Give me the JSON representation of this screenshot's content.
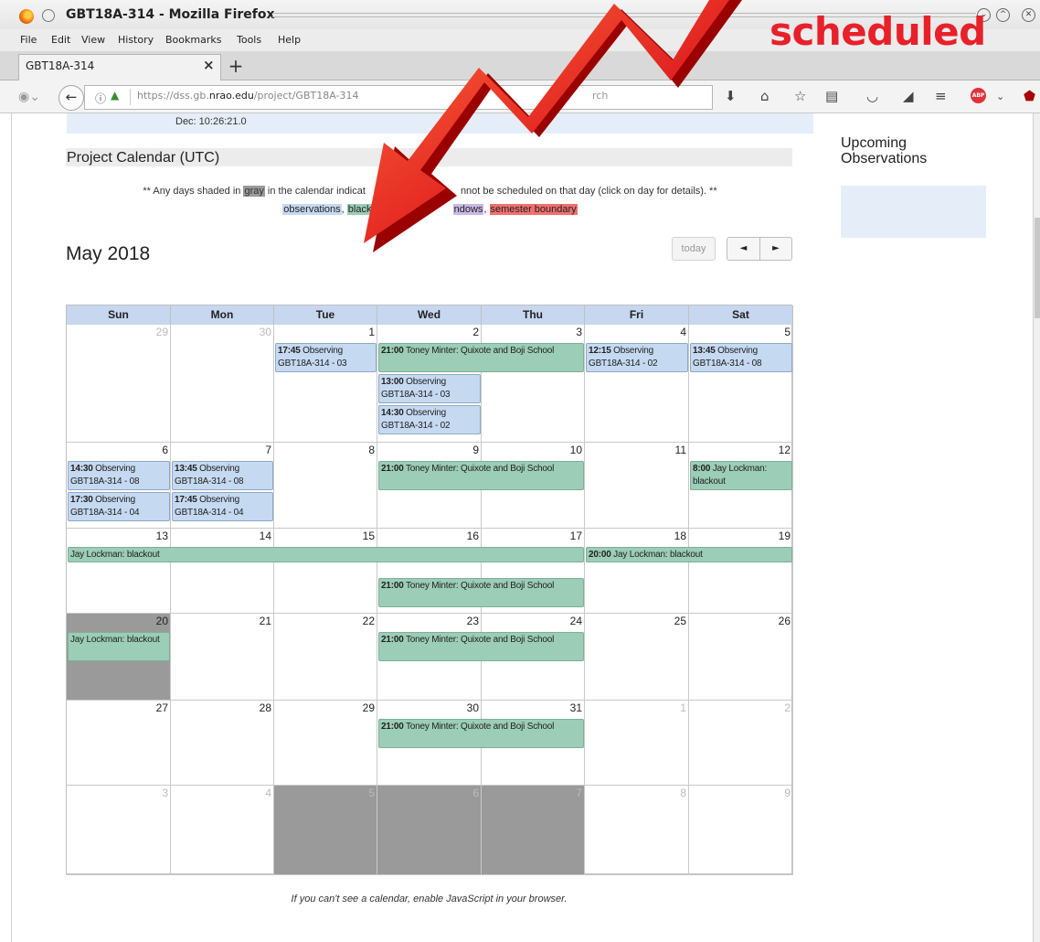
{
  "window": {
    "title": "GBT18A-314 - Mozilla Firefox"
  },
  "menu": [
    "File",
    "Edit",
    "View",
    "History",
    "Bookmarks",
    "Tools",
    "Help"
  ],
  "tab": {
    "label": "GBT18A-314",
    "close": "×",
    "new": "+"
  },
  "nav": {
    "url_prefix": "https://dss.gb.",
    "url_domain": "nrao.edu",
    "url_path": "/project/GBT18A-314",
    "search_placeholder": "rch"
  },
  "page": {
    "dec_line": "Dec: 10:26:21.0",
    "section_title": "Project Calendar (UTC)",
    "notice_prefix": "** Any days shaded in ",
    "notice_gray": "gray",
    "notice_mid": " in the calendar indicat",
    "notice_suffix": "nnot be scheduled on that day (click on day for details). **",
    "legend": {
      "obs": "observations",
      "sep1": ", ",
      "blk": "blacko",
      "win": "ndows",
      "sep3": ", ",
      "sem": "semester boundary"
    },
    "month": "May 2018",
    "today_label": "today",
    "prev_label": "◄",
    "next_label": "►",
    "footer_note": "If you can't see a calendar, enable JavaScript in your browser."
  },
  "calendar": {
    "days": [
      "Sun",
      "Mon",
      "Tue",
      "Wed",
      "Thu",
      "Fri",
      "Sat"
    ],
    "weeks": [
      [
        {
          "n": "29",
          "o": true
        },
        {
          "n": "30",
          "o": true
        },
        {
          "n": "1"
        },
        {
          "n": "2"
        },
        {
          "n": "3"
        },
        {
          "n": "4"
        },
        {
          "n": "5"
        }
      ],
      [
        {
          "n": "6"
        },
        {
          "n": "7"
        },
        {
          "n": "8"
        },
        {
          "n": "9"
        },
        {
          "n": "10"
        },
        {
          "n": "11"
        },
        {
          "n": "12"
        }
      ],
      [
        {
          "n": "13"
        },
        {
          "n": "14"
        },
        {
          "n": "15"
        },
        {
          "n": "16"
        },
        {
          "n": "17"
        },
        {
          "n": "18"
        },
        {
          "n": "19"
        }
      ],
      [
        {
          "n": "20",
          "g": true
        },
        {
          "n": "21"
        },
        {
          "n": "22"
        },
        {
          "n": "23"
        },
        {
          "n": "24"
        },
        {
          "n": "25"
        },
        {
          "n": "26"
        }
      ],
      [
        {
          "n": "27"
        },
        {
          "n": "28"
        },
        {
          "n": "29"
        },
        {
          "n": "30"
        },
        {
          "n": "31"
        },
        {
          "n": "1",
          "o": true
        },
        {
          "n": "2",
          "o": true
        }
      ],
      [
        {
          "n": "3",
          "o": true
        },
        {
          "n": "4",
          "o": true
        },
        {
          "n": "5",
          "o": true,
          "g": true
        },
        {
          "n": "6",
          "o": true,
          "g": true
        },
        {
          "n": "7",
          "o": true,
          "g": true
        },
        {
          "n": "8",
          "o": true
        },
        {
          "n": "9",
          "o": true
        }
      ]
    ],
    "events": [
      {
        "w": 0,
        "d": 2,
        "span": 1,
        "row": 0,
        "type": "obs",
        "time": "17:45",
        "text": "Observing GBT18A-314 - 03"
      },
      {
        "w": 0,
        "d": 3,
        "span": 2,
        "row": 0,
        "type": "blk",
        "time": "21:00",
        "text": "Toney Minter: Quixote and Boji School"
      },
      {
        "w": 0,
        "d": 3,
        "span": 1,
        "row": 1,
        "type": "obs",
        "time": "13:00",
        "text": "Observing GBT18A-314 - 03"
      },
      {
        "w": 0,
        "d": 3,
        "span": 1,
        "row": 2,
        "type": "obs",
        "time": "14:30",
        "text": "Observing GBT18A-314 - 02"
      },
      {
        "w": 0,
        "d": 5,
        "span": 1,
        "row": 0,
        "type": "obs",
        "time": "12:15",
        "text": "Observing GBT18A-314 - 02"
      },
      {
        "w": 0,
        "d": 6,
        "span": 1,
        "row": 0,
        "type": "obs",
        "time": "13:45",
        "text": "Observing GBT18A-314 - 08"
      },
      {
        "w": 1,
        "d": 0,
        "span": 1,
        "row": 0,
        "type": "obs",
        "time": "14:30",
        "text": "Observing GBT18A-314 - 08"
      },
      {
        "w": 1,
        "d": 0,
        "span": 1,
        "row": 1,
        "type": "obs",
        "time": "17:30",
        "text": "Observing GBT18A-314 - 04"
      },
      {
        "w": 1,
        "d": 1,
        "span": 1,
        "row": 0,
        "type": "obs",
        "time": "13:45",
        "text": "Observing GBT18A-314 - 08"
      },
      {
        "w": 1,
        "d": 1,
        "span": 1,
        "row": 1,
        "type": "obs",
        "time": "17:45",
        "text": "Observing GBT18A-314 - 04"
      },
      {
        "w": 1,
        "d": 3,
        "span": 2,
        "row": 0,
        "type": "blk",
        "time": "21:00",
        "text": "Toney Minter: Quixote and Boji School"
      },
      {
        "w": 1,
        "d": 6,
        "span": 1,
        "row": 0,
        "type": "blk",
        "time": "8:00",
        "text": "Jay Lockman: blackout"
      },
      {
        "w": 2,
        "d": 0,
        "span": 5,
        "row": 0,
        "type": "blk",
        "time": "",
        "text": "Jay Lockman: blackout"
      },
      {
        "w": 2,
        "d": 3,
        "span": 2,
        "row": 1,
        "type": "blk",
        "time": "21:00",
        "text": "Toney Minter: Quixote and Boji School"
      },
      {
        "w": 2,
        "d": 5,
        "span": 2,
        "row": 0,
        "type": "blk",
        "time": "20:00",
        "text": "Jay Lockman: blackout"
      },
      {
        "w": 3,
        "d": 0,
        "span": 1,
        "row": 0,
        "type": "blk",
        "time": "",
        "text": "Jay Lockman: blackout"
      },
      {
        "w": 3,
        "d": 3,
        "span": 2,
        "row": 0,
        "type": "blk",
        "time": "21:00",
        "text": "Toney Minter: Quixote and Boji School"
      },
      {
        "w": 4,
        "d": 3,
        "span": 2,
        "row": 0,
        "type": "blk",
        "time": "21:00",
        "text": "Toney Minter: Quixote and Boji School"
      }
    ]
  },
  "sidebar": {
    "title": "Upcoming Observations"
  },
  "annotation": {
    "text": "scheduled"
  },
  "colors": {
    "obs": "#c5d9f1",
    "blackout": "#9ccdb6",
    "window": "#c9b8e3",
    "semester": "#f07070",
    "gray_day": "#9a9a9a",
    "callout": "#e8202a"
  }
}
